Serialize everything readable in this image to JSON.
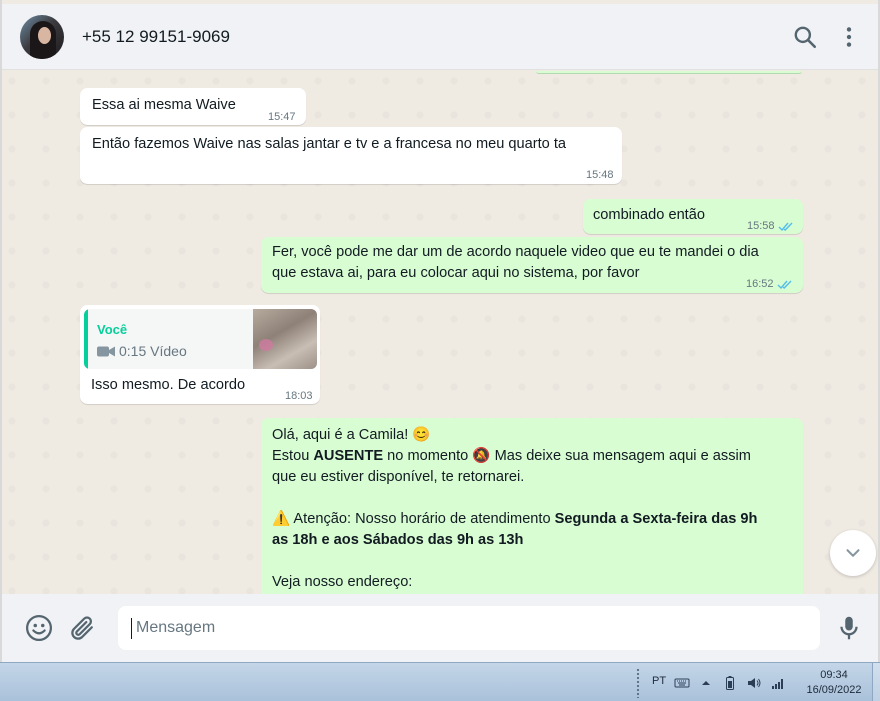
{
  "header": {
    "contact_name": "+55 12 99151-9069",
    "avatar_icon": "contact-avatar",
    "search_icon": "search-icon",
    "menu_icon": "more-vertical-icon"
  },
  "messages": [
    {
      "direction": "in",
      "text": "Essa ai mesma Waive",
      "time": "15:47"
    },
    {
      "direction": "in",
      "text": "Então fazemos Waive nas salas jantar e tv e a francesa no meu quarto ta",
      "time": "15:48"
    },
    {
      "direction": "out",
      "text": "combinado então",
      "time": "15:58",
      "status": "read"
    },
    {
      "direction": "out",
      "text_line1": "Fer, você pode me dar um de acordo naquele video que eu te mandei o dia",
      "text_line2": "que estava ai, para eu colocar aqui no sistema, por favor",
      "time": "16:52",
      "status": "read"
    },
    {
      "direction": "in",
      "quote": {
        "author": "Você",
        "media_label": "0:15 Vídeo",
        "media_icon": "video-camera-icon"
      },
      "text": "Isso mesmo. De acordo",
      "time": "18:03"
    },
    {
      "direction": "out",
      "line1": "Olá, aqui é a Camila! 😊",
      "line2_pre": "Estou ",
      "line2_bold": "AUSENTE",
      "line2_post": " no momento 🔕 Mas deixe sua mensagem aqui e assim",
      "line3": "que eu estiver disponível, te retornarei.",
      "line4_pre": "⚠️ Atenção: Nosso horário de atendimento ",
      "line4_bold": "Segunda a Sexta-feira das 9h",
      "line5_bold": "as 18h e aos Sábados das 9h as 13h",
      "line6": "Veja nosso endereço:"
    }
  ],
  "footer": {
    "input_placeholder": "Mensagem",
    "emoji_icon": "emoji-icon",
    "attach_icon": "paperclip-icon",
    "mic_icon": "microphone-icon"
  },
  "taskbar": {
    "language": "PT",
    "time": "09:34",
    "date": "16/09/2022"
  },
  "colors": {
    "outgoing_bubble": "#d9fdd3",
    "incoming_bubble": "#ffffff",
    "accent": "#06cf9c",
    "read_ticks": "#53bdeb"
  }
}
